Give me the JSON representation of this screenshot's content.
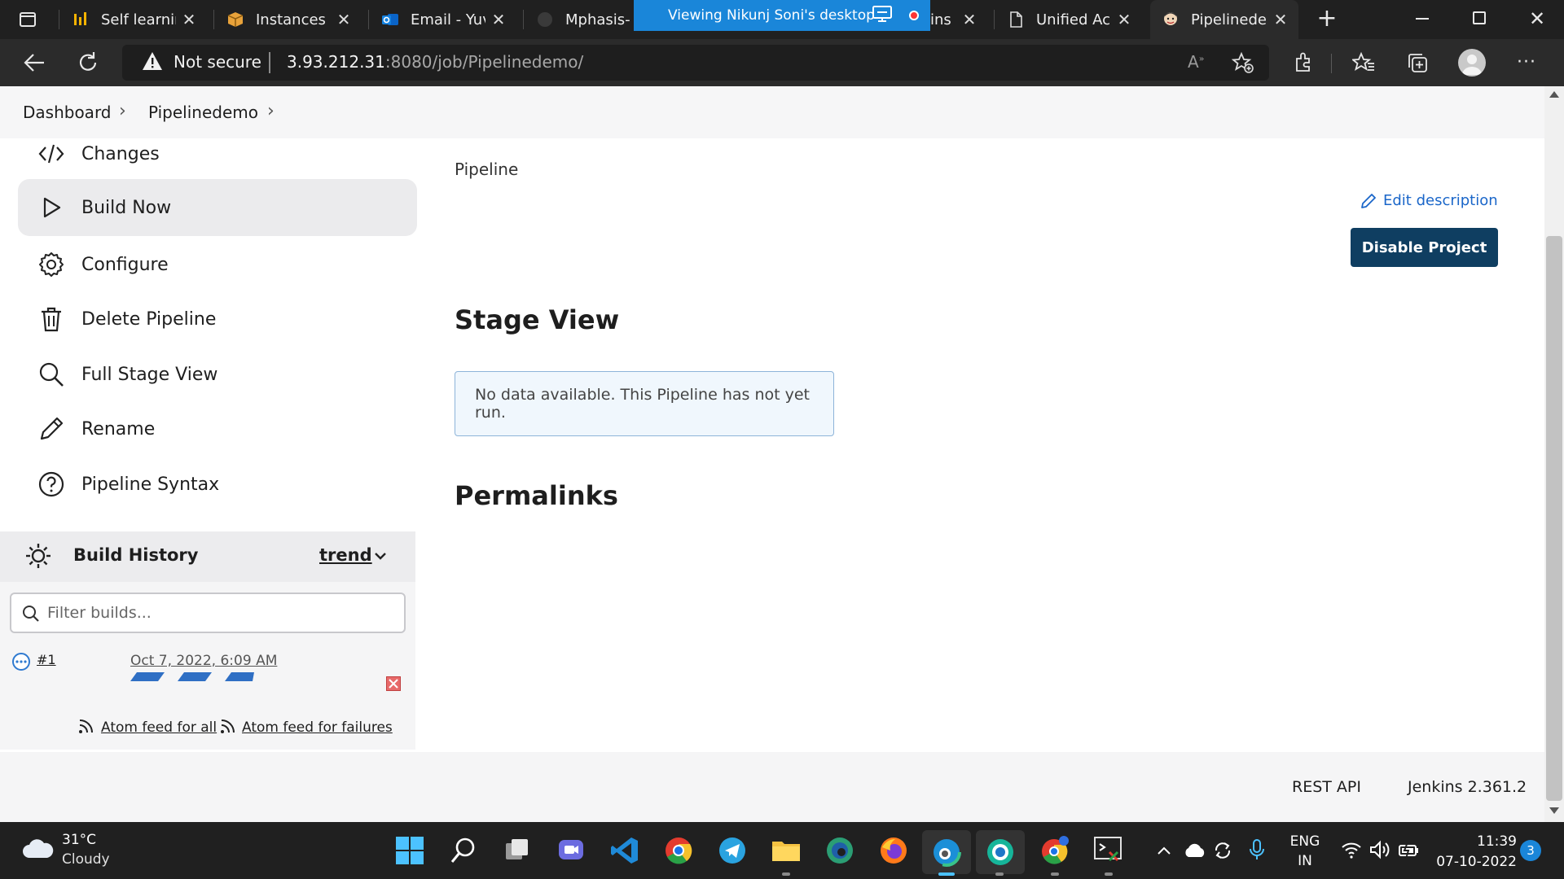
{
  "browser": {
    "tabs": [
      {
        "label": "Self learning",
        "icon": "bar-chart-logo-icon"
      },
      {
        "label": "Instances | E",
        "icon": "aws-box-icon"
      },
      {
        "label": "Email - Yuva",
        "icon": "outlook-icon"
      },
      {
        "label": "Mphasis-",
        "icon": "github-icon"
      },
      {
        "label": "ins (",
        "icon": "generic-icon"
      },
      {
        "label": "Unified Acc",
        "icon": "document-icon"
      },
      {
        "label": "Pipelinedem",
        "icon": "jenkins-icon"
      }
    ],
    "remote_banner": "Viewing Nikunj Soni's desktop",
    "security_label": "Not secure",
    "url_host": "3.93.212.31",
    "url_rest": ":8080/job/Pipelinedemo/"
  },
  "breadcrumb": {
    "items": [
      "Dashboard",
      "Pipelinedemo"
    ]
  },
  "sidebar": {
    "items": [
      {
        "label": "Changes",
        "icon": "code-icon"
      },
      {
        "label": "Build Now",
        "icon": "play-icon"
      },
      {
        "label": "Configure",
        "icon": "gear-icon"
      },
      {
        "label": "Delete Pipeline",
        "icon": "trash-icon"
      },
      {
        "label": "Full Stage View",
        "icon": "magnifier-icon"
      },
      {
        "label": "Rename",
        "icon": "pencil-icon"
      },
      {
        "label": "Pipeline Syntax",
        "icon": "help-circle-icon"
      }
    ]
  },
  "build_history": {
    "title": "Build History",
    "trend_label": "trend",
    "filter_placeholder": "Filter builds...",
    "builds": [
      {
        "number": "#1",
        "date": "Oct 7, 2022, 6:09 AM"
      }
    ],
    "atom_all": "Atom feed for all",
    "atom_failures": "Atom feed for failures"
  },
  "main": {
    "title": "Pipeline",
    "edit_description": "Edit description",
    "disable_button": "Disable Project",
    "stage_view_title": "Stage View",
    "stage_view_message": "No data available. This Pipeline has not yet run.",
    "permalinks_title": "Permalinks"
  },
  "footer": {
    "rest_api": "REST API",
    "version": "Jenkins 2.361.2"
  },
  "taskbar": {
    "weather_temp": "31°C",
    "weather_desc": "Cloudy",
    "lang_top": "ENG",
    "lang_bottom": "IN",
    "time": "11:39",
    "date": "07-10-2022",
    "notification_count": "3"
  },
  "colors": {
    "accent": "#0f3e61",
    "link": "#1a66c9",
    "remote_banner": "#1a86d9"
  }
}
